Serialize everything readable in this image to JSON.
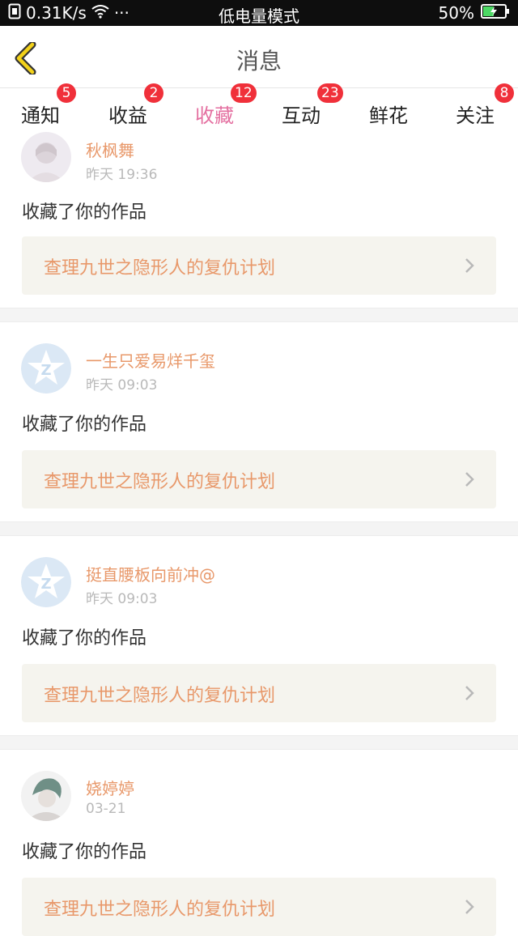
{
  "status_bar": {
    "net_speed": "0.31K/s",
    "more": "···",
    "mode": "低电量模式",
    "battery": "50%",
    "battery_level": 0.5
  },
  "header": {
    "title": "消息",
    "back_icon": "chevron-left-icon"
  },
  "tabs": [
    {
      "label": "通知",
      "badge": "5"
    },
    {
      "label": "收益",
      "badge": "2"
    },
    {
      "label": "收藏",
      "badge": "12",
      "active": true
    },
    {
      "label": "互动",
      "badge": "23"
    },
    {
      "label": "鲜花",
      "badge": ""
    },
    {
      "label": "关注",
      "badge": "8"
    }
  ],
  "items": [
    {
      "user": "秋枫舞",
      "time": "昨天 19:36",
      "action": "收藏了你的作品",
      "work": "查理九世之隐形人的复仇计划",
      "avatar": "photo-avatar-icon"
    },
    {
      "user": "一生只爱易烊千玺",
      "time": "昨天 09:03",
      "action": "收藏了你的作品",
      "work": "查理九世之隐形人的复仇计划",
      "avatar": "default-avatar-icon"
    },
    {
      "user": "挺直腰板向前冲@",
      "time": "昨天 09:03",
      "action": "收藏了你的作品",
      "work": "查理九世之隐形人的复仇计划",
      "avatar": "default-avatar-icon"
    },
    {
      "user": "娆婷婷",
      "time": "03-21",
      "action": "收藏了你的作品",
      "work": "查理九世之隐形人的复仇计划",
      "avatar": "photo-avatar-icon"
    }
  ],
  "colors": {
    "accent": "#e46fa0",
    "badge": "#f0303a",
    "name": "#e8986a",
    "work_bg": "#f5f4ee"
  }
}
